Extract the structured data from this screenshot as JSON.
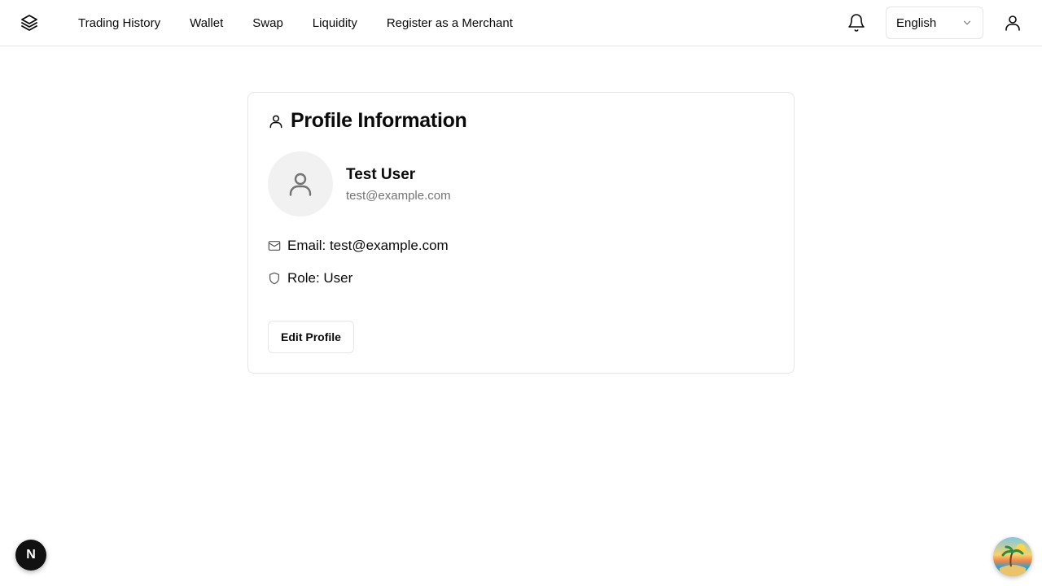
{
  "nav": {
    "items": [
      {
        "label": "Trading History"
      },
      {
        "label": "Wallet"
      },
      {
        "label": "Swap"
      },
      {
        "label": "Liquidity"
      },
      {
        "label": "Register as a Merchant"
      }
    ]
  },
  "header": {
    "language": "English",
    "icons": [
      "layers-icon",
      "bell-icon",
      "chevron-down-icon",
      "user-icon"
    ]
  },
  "profile": {
    "title": "Profile Information",
    "name": "Test User",
    "email": "test@example.com",
    "email_line": "Email: test@example.com",
    "role_line": "Role: User",
    "edit_label": "Edit Profile"
  },
  "badges": {
    "dev_badge": "N"
  },
  "colors": {
    "text": "#0a0a0a",
    "muted": "#737373",
    "border": "#e5e5e5",
    "avatar_bg": "#f1f1f1"
  }
}
